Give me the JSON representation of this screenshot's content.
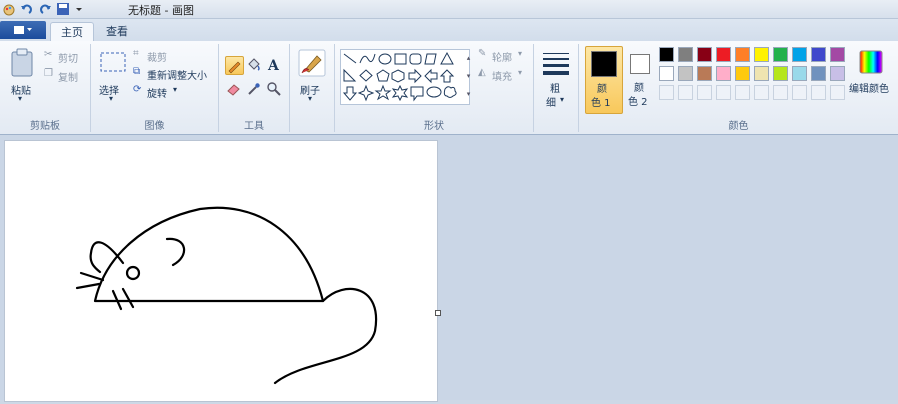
{
  "window": {
    "title": "无标题 - 画图"
  },
  "tabs": {
    "home": "主页",
    "view": "查看"
  },
  "clipboard": {
    "paste": "粘贴",
    "cut": "剪切",
    "copy": "复制",
    "group": "剪贴板"
  },
  "image": {
    "select": "选择",
    "crop": "裁剪",
    "resize": "重新调整大小",
    "rotate": "旋转",
    "group": "图像"
  },
  "tools": {
    "group": "工具"
  },
  "brush": {
    "label": "刷子"
  },
  "shapes": {
    "outline": "轮廓",
    "fill": "填充",
    "group": "形状"
  },
  "size": {
    "label1": "粗",
    "label2": "细"
  },
  "colors": {
    "color1_label1": "颜",
    "color1_label2": "色 1",
    "color2_label1": "颜",
    "color2_label2": "色 2",
    "edit": "编辑颜色",
    "group": "颜色",
    "color1": "#000000",
    "color2": "#ffffff",
    "row1": [
      "#000000",
      "#7f7f7f",
      "#880015",
      "#ed1c24",
      "#ff7f27",
      "#fff200",
      "#22b14c",
      "#00a2e8",
      "#3f48cc",
      "#a349a4"
    ],
    "row2": [
      "#ffffff",
      "#c3c3c3",
      "#b97a57",
      "#ffaec9",
      "#ffc90e",
      "#efe4b0",
      "#b5e61d",
      "#99d9ea",
      "#7092be",
      "#c8bfe7"
    ]
  }
}
